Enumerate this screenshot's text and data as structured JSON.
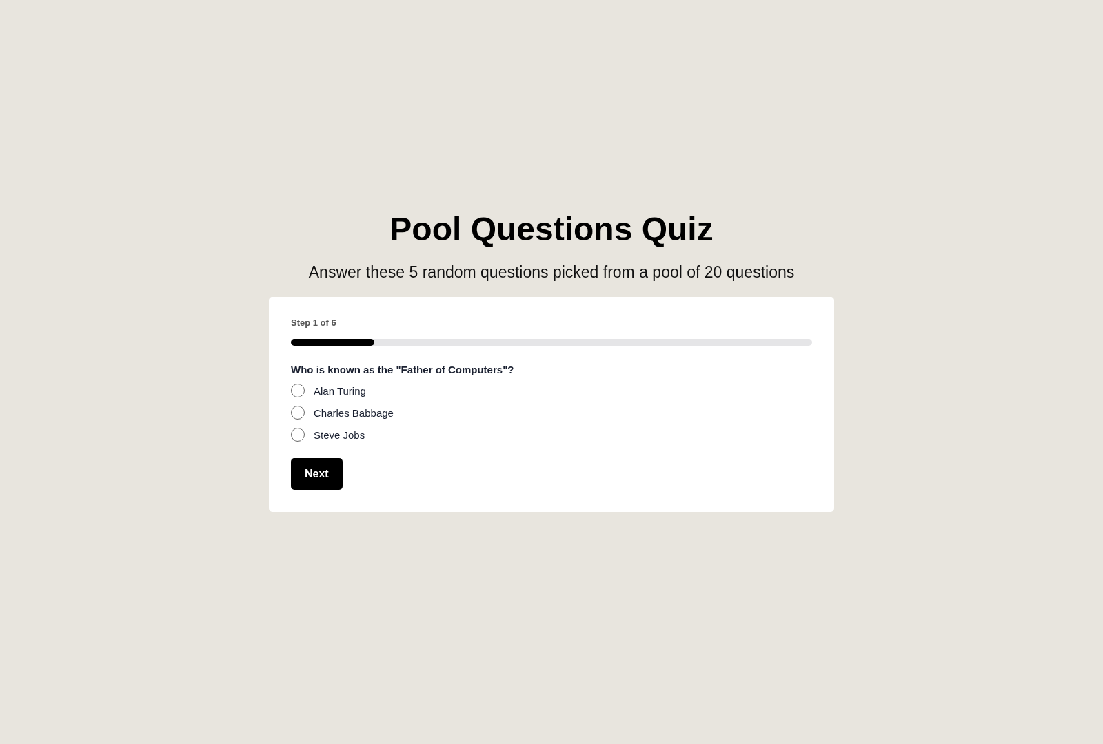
{
  "title": "Pool Questions Quiz",
  "subtitle": "Answer these 5 random questions picked from a pool of 20 questions",
  "step": {
    "label": "Step 1 of 6",
    "level": 0.16
  },
  "question": "Who is known as the \"Father of Computers\"?",
  "options": [
    {
      "label": "Alan Turing",
      "selected": false
    },
    {
      "label": "Charles Babbage",
      "selected": false
    },
    {
      "label": "Steve Jobs",
      "selected": false
    }
  ],
  "button": "Next"
}
